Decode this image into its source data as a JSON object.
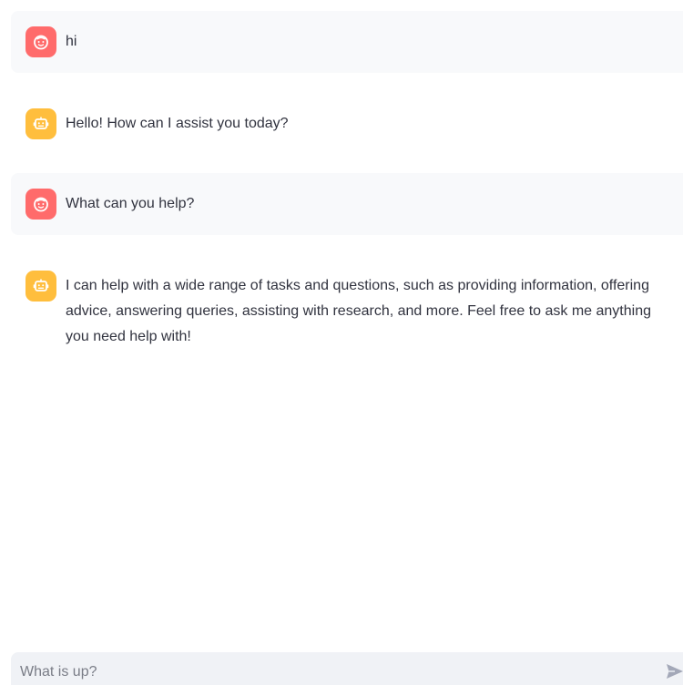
{
  "conversation": {
    "messages": [
      {
        "role": "user",
        "avatar_icon": "user-face-icon",
        "text": "hi"
      },
      {
        "role": "assistant",
        "avatar_icon": "robot-icon",
        "text": "Hello! How can I assist you today?"
      },
      {
        "role": "user",
        "avatar_icon": "user-face-icon",
        "text": "What can you help?"
      },
      {
        "role": "assistant",
        "avatar_icon": "robot-icon",
        "text": "I can help with a wide range of tasks and questions, such as providing information, offering advice, answering queries, assisting with research, and more. Feel free to ask me anything you need help with!"
      }
    ]
  },
  "chat_input": {
    "placeholder": "What is up?",
    "value": "",
    "send_icon": "send-icon"
  },
  "colors": {
    "user_avatar": "#ff6b6b",
    "assistant_avatar": "#ffbe3d",
    "user_message_bg": "#f8f9fb",
    "input_bg": "#f0f2f6",
    "text": "#31333f"
  }
}
